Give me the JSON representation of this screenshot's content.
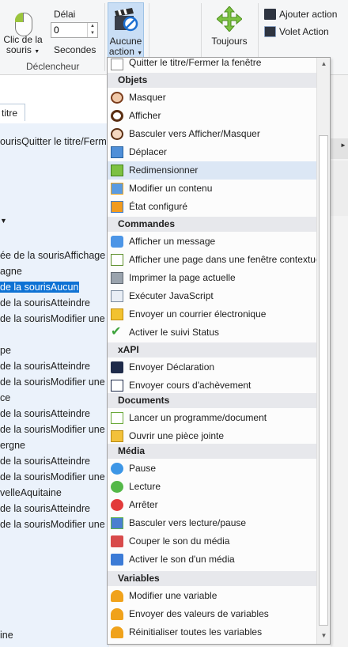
{
  "ribbon": {
    "click_label_1": "Clic de la",
    "click_label_2": "souris",
    "delay_label": "Délai",
    "delay_value": "0",
    "seconds_label": "Secondes",
    "trigger_group": "Déclencheur",
    "action_label_1": "Aucune",
    "action_label_2": "action",
    "always_label": "Toujours",
    "add_action": "Ajouter action",
    "action_pane": "Volet Action"
  },
  "tab": {
    "label": "titre"
  },
  "rows": [
    "ourisQuitter le titre/Ferm",
    "",
    "",
    "",
    "",
    "ée de la sourisAffichage",
    "agne",
    "de la sourisAucun",
    "de la sourisAtteindre",
    "de la sourisModifier une",
    "",
    "pe",
    "de la sourisAtteindre",
    "de la sourisModifier une",
    "ce",
    "de la sourisAtteindre",
    "de la sourisModifier une",
    "ergne",
    "de la sourisAtteindre",
    "de la sourisModifier une",
    "velleAquitaine",
    "de la sourisAtteindre",
    "de la sourisModifier une",
    "ine"
  ],
  "menu": {
    "top_item": "Quitter le titre/Fermer la fenêtre",
    "sections": [
      {
        "title": "Objets",
        "items": [
          {
            "label": "Masquer",
            "icon": "hide-eye-icon"
          },
          {
            "label": "Afficher",
            "icon": "show-eye-icon"
          },
          {
            "label": "Basculer vers Afficher/Masquer",
            "icon": "toggle-eye-icon"
          },
          {
            "label": "Déplacer",
            "icon": "move-icon"
          },
          {
            "label": "Redimensionner",
            "icon": "resize-icon"
          },
          {
            "label": "Modifier un contenu",
            "icon": "edit-content-icon"
          },
          {
            "label": "État configuré",
            "icon": "state-icon"
          }
        ]
      },
      {
        "title": "Commandes",
        "items": [
          {
            "label": "Afficher un message",
            "icon": "message-icon"
          },
          {
            "label": "Afficher une page dans une fenêtre contextue",
            "icon": "popup-page-icon"
          },
          {
            "label": "Imprimer la page actuelle",
            "icon": "print-icon"
          },
          {
            "label": "Exécuter JavaScript",
            "icon": "javascript-icon"
          },
          {
            "label": "Envoyer un courrier électronique",
            "icon": "email-icon"
          },
          {
            "label": "Activer le suivi Status",
            "icon": "check-icon"
          }
        ]
      },
      {
        "title": "xAPI",
        "items": [
          {
            "label": "Envoyer Déclaration",
            "icon": "xapi-statement-icon"
          },
          {
            "label": "Envoyer cours d'achèvement",
            "icon": "xapi-completion-icon"
          }
        ]
      },
      {
        "title": "Documents",
        "items": [
          {
            "label": "Lancer un programme/document",
            "icon": "launch-icon"
          },
          {
            "label": "Ouvrir une pièce jointe",
            "icon": "attachment-icon"
          }
        ]
      },
      {
        "title": "Média",
        "items": [
          {
            "label": "Pause",
            "icon": "pause-icon"
          },
          {
            "label": "Lecture",
            "icon": "play-icon"
          },
          {
            "label": "Arrêter",
            "icon": "stop-icon"
          },
          {
            "label": "Basculer vers lecture/pause",
            "icon": "toggle-play-icon"
          },
          {
            "label": "Couper le son du média",
            "icon": "mute-icon"
          },
          {
            "label": "Activer le son d'un média",
            "icon": "unmute-icon"
          }
        ]
      },
      {
        "title": "Variables",
        "items": [
          {
            "label": "Modifier une variable",
            "icon": "var-edit-icon"
          },
          {
            "label": "Envoyer des valeurs de variables",
            "icon": "var-send-icon"
          },
          {
            "label": "Réinitialiser toutes les variables",
            "icon": "var-reset-icon"
          }
        ]
      }
    ],
    "highlighted": "Redimensionner"
  },
  "colors": {
    "selection": "#0e72d4",
    "panel": "#ebf2fb",
    "menu_highlight": "#dce7f5",
    "header_bg": "#e7e8ec"
  }
}
